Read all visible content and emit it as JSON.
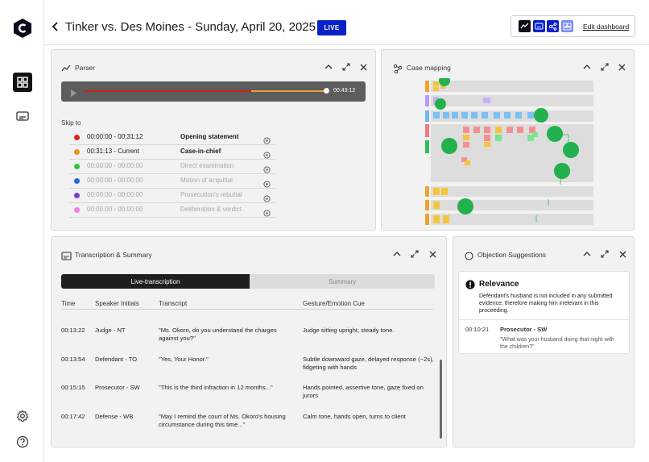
{
  "header": {
    "title": "Tinker vs. Des Moines - Sunday, April 20, 2025",
    "live_label": "LIVE",
    "edit_dashboard_label": "Edit dashboard"
  },
  "parser": {
    "title": "Parser",
    "player_time": "00:43:12",
    "skip_label": "Skip to",
    "items": [
      {
        "time": "00:00:00 - 00:31:12",
        "name": "Opening statement",
        "color": "#e02424",
        "state": "done"
      },
      {
        "time": "00:31:13  - Current",
        "name": "Case-in-chief",
        "color": "#f0901a",
        "state": "current"
      },
      {
        "time": "00:00:00 - 00:00:00",
        "name": "Direct examination",
        "color": "#27c93f",
        "state": "future"
      },
      {
        "time": "00:00:00 - 00:00:00",
        "name": "Motion of acquittal",
        "color": "#1f6fe0",
        "state": "future"
      },
      {
        "time": "00:00:00 - 00:00:00",
        "name": "Prosecution's rebuttal",
        "color": "#7b3fd6",
        "state": "future"
      },
      {
        "time": "00:00:00 - 00:00:00",
        "name": "Deliberation & verdict",
        "color": "#f27fe0",
        "state": "future"
      }
    ]
  },
  "case_mapping": {
    "title": "Case mapping"
  },
  "transcription": {
    "title": "Transcription & Summary",
    "tabs": [
      "Live-transcription",
      "Summary"
    ],
    "columns": [
      "Time",
      "Speaker Initials",
      "Transcript",
      "Gesture/Emotion Cue"
    ],
    "rows": [
      {
        "time": "00:13:22",
        "speaker": "Judge - NT",
        "transcript": "\"Ms. Okoro, do you understand the charges against you?\"",
        "cue": "Judge sitting upright, steady tone."
      },
      {
        "time": "00:13:54",
        "speaker": "Defendant - TO",
        "transcript": "\"Yes, Your Honor.\"",
        "cue": "Subtle downward gaze, delayed response (~2s), fidgeting with hands"
      },
      {
        "time": "00:15:15",
        "speaker": "Prosecutor - SW",
        "transcript": "\"This is the third infraction in 12 months...\"",
        "cue": "Hands pointed, assertive tone, gaze fixed on jurors"
      },
      {
        "time": "00:17:42",
        "speaker": "Defense - WB",
        "transcript": "\"May I remind the court of Ms. Okoro's housing circumstance during this time...\"",
        "cue": "Calm tone, hands open, turns to client"
      }
    ]
  },
  "objection": {
    "title": "Objection Suggestions",
    "card_title": "Relevance",
    "card_desc": "Defendant's husband is not included in any submitted evidence, therefore making him irrelevant in this proceeding.",
    "time": "00:10:21",
    "speaker": "Prosecutor - SW",
    "quote": "\"What was your husband doing that night with the children?\""
  },
  "colors": {
    "accent": "#0a21c8",
    "live_badge": "#0a21c8",
    "player_bg": "#5d5d5d",
    "progress_done": "#d11d1d",
    "progress_current": "#e9a13a"
  }
}
